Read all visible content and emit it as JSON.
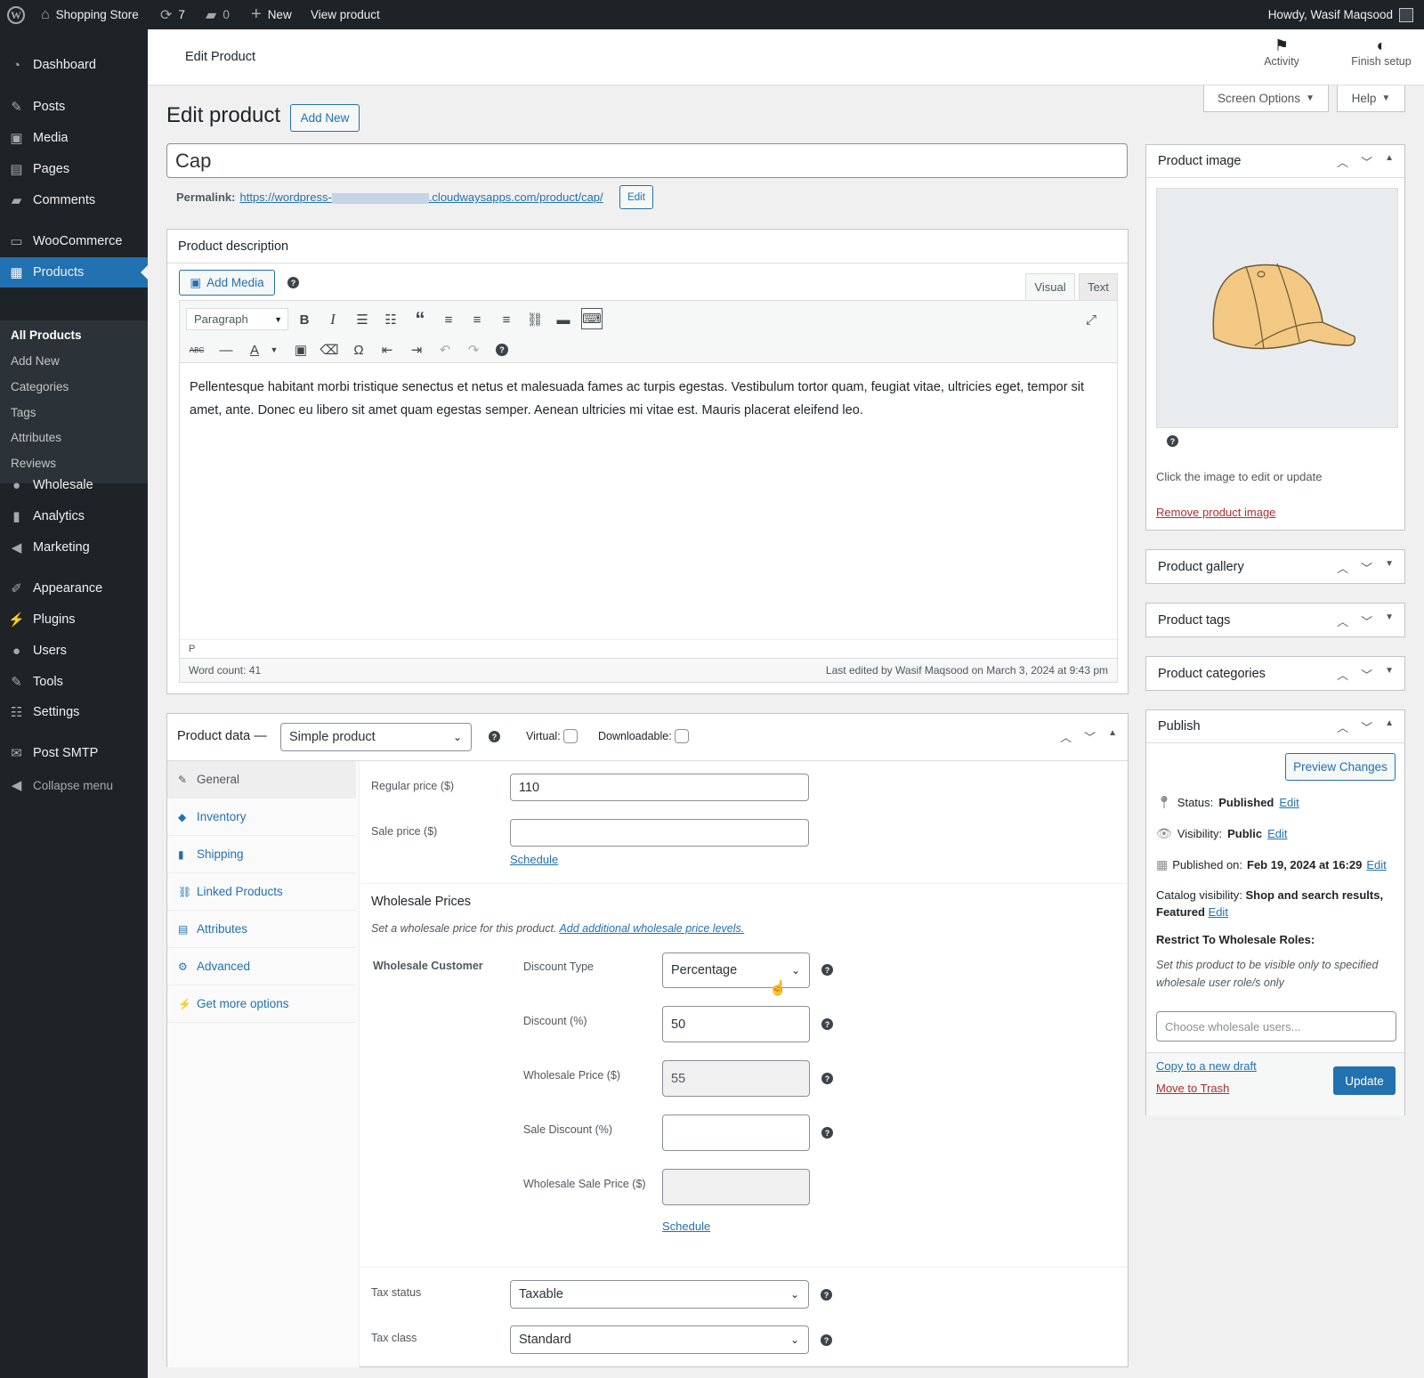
{
  "adminbar": {
    "site_name": "Shopping Store",
    "updates_count": "7",
    "comments_count": "0",
    "new_label": "New",
    "view_label": "View product",
    "howdy": "Howdy, Wasif Maqsood"
  },
  "sidebar": {
    "items": [
      {
        "label": "Dashboard",
        "icon": "dashboard-icon"
      },
      {
        "label": "Posts",
        "icon": "pin-icon"
      },
      {
        "label": "Media",
        "icon": "media-icon"
      },
      {
        "label": "Pages",
        "icon": "pages-icon"
      },
      {
        "label": "Comments",
        "icon": "comment-icon"
      },
      {
        "label": "WooCommerce",
        "icon": "woo-icon"
      },
      {
        "label": "Products",
        "icon": "products-icon"
      },
      {
        "label": "Wholesale",
        "icon": "wholesale-icon"
      },
      {
        "label": "Analytics",
        "icon": "analytics-icon"
      },
      {
        "label": "Marketing",
        "icon": "megaphone-icon"
      },
      {
        "label": "Appearance",
        "icon": "brush-icon"
      },
      {
        "label": "Plugins",
        "icon": "plugin-icon"
      },
      {
        "label": "Users",
        "icon": "user-icon"
      },
      {
        "label": "Tools",
        "icon": "wrench-icon"
      },
      {
        "label": "Settings",
        "icon": "settings-icon"
      },
      {
        "label": "Post SMTP",
        "icon": "mail-icon"
      },
      {
        "label": "Collapse menu",
        "icon": "collapse-icon"
      }
    ],
    "submenu": [
      "All Products",
      "Add New",
      "Categories",
      "Tags",
      "Attributes",
      "Reviews"
    ]
  },
  "header": {
    "title": "Edit Product",
    "activity": "Activity",
    "finish_setup": "Finish setup"
  },
  "screen_options": "Screen Options",
  "help": "Help",
  "page": {
    "title": "Edit product",
    "add_new": "Add New",
    "product_title": "Cap",
    "permalink_label": "Permalink:",
    "permalink_start": "https://wordpress-",
    "permalink_end": ".cloudwaysapps.com/product/cap/",
    "permalink_edit": "Edit"
  },
  "description": {
    "heading": "Product description",
    "add_media": "Add Media",
    "tab_visual": "Visual",
    "tab_text": "Text",
    "format": "Paragraph",
    "content": "Pellentesque habitant morbi tristique senectus et netus et malesuada fames ac turpis egestas. Vestibulum tortor quam, feugiat vitae, ultricies eget, tempor sit amet, ante. Donec eu libero sit amet quam egestas semper. Aenean ultricies mi vitae est. Mauris placerat eleifend leo.",
    "path": "P",
    "word_count": "Word count: 41",
    "last_edited": "Last edited by Wasif Maqsood on March 3, 2024 at 9:43 pm"
  },
  "product_data": {
    "heading": "Product data —",
    "type": "Simple product",
    "virtual": "Virtual:",
    "downloadable": "Downloadable:",
    "tabs": [
      "General",
      "Inventory",
      "Shipping",
      "Linked Products",
      "Attributes",
      "Advanced",
      "Get more options"
    ],
    "regular_price_label": "Regular price ($)",
    "regular_price": "110",
    "sale_price_label": "Sale price ($)",
    "sale_price": "",
    "schedule": "Schedule",
    "wholesale_heading": "Wholesale Prices",
    "wholesale_desc": "Set a wholesale price for this product.",
    "wholesale_link": "Add additional wholesale price levels.",
    "wholesale_role": "Wholesale Customer",
    "discount_type_label": "Discount Type",
    "discount_type": "Percentage",
    "discount_label": "Discount (%)",
    "discount": "50",
    "wholesale_price_label": "Wholesale Price ($)",
    "wholesale_price": "55",
    "sale_discount_label": "Sale Discount (%)",
    "wholesale_sale_price_label": "Wholesale Sale Price ($)",
    "schedule2": "Schedule",
    "tax_status_label": "Tax status",
    "tax_status": "Taxable",
    "tax_class_label": "Tax class",
    "tax_class": "Standard"
  },
  "side": {
    "product_image": "Product image",
    "image_hint": "Click the image to edit or update",
    "remove_image": "Remove product image",
    "gallery": "Product gallery",
    "tags": "Product tags",
    "categories": "Product categories",
    "publish": "Publish",
    "preview": "Preview Changes",
    "status_label": "Status:",
    "status_value": "Published",
    "visibility_label": "Visibility:",
    "visibility_value": "Public",
    "published_label": "Published on:",
    "published_value": "Feb 19, 2024 at 16:29",
    "edit": "Edit",
    "catalog_label": "Catalog visibility:",
    "catalog_value": "Shop and search results,",
    "catalog_value2": "Featured",
    "restrict_heading": "Restrict To Wholesale Roles:",
    "restrict_desc": "Set this product to be visible only to specified wholesale user role/s only",
    "restrict_placeholder": "Choose wholesale users...",
    "copy_draft": "Copy to a new draft",
    "trash": "Move to Trash",
    "update": "Update"
  },
  "colors": {
    "accent": "#2271b1",
    "sidebar": "#1d2327",
    "danger": "#b32d2e"
  }
}
